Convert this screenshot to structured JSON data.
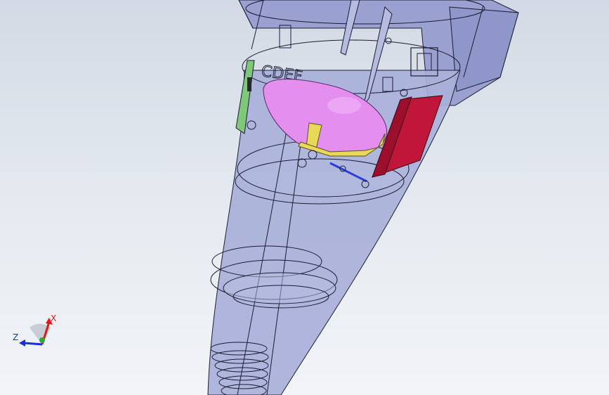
{
  "viewport": {
    "background_top": "#d3dae5",
    "background_bottom": "#f2f4f7"
  },
  "model": {
    "body_color": "#a4acd7",
    "edge_color": "#1b1d33",
    "parts": [
      {
        "name": "nose-cone",
        "color": "#a4acd7"
      },
      {
        "name": "reflector-dish",
        "color": "#e48ff0"
      },
      {
        "name": "support-bracket",
        "color": "#e8d957"
      },
      {
        "name": "red-panel",
        "color": "#c0163a"
      },
      {
        "name": "green-board",
        "color": "#7fc87a"
      },
      {
        "name": "blue-shaft",
        "color": "#2a3fd8"
      }
    ],
    "engraved_text": "CDEF"
  },
  "triad": {
    "x_label": "X",
    "z_label": "Z",
    "x_color": "#e01a1a",
    "z_color": "#1a2fd8",
    "y_color": "#2fa83a",
    "icons": [
      "axis-triad-icon"
    ]
  }
}
